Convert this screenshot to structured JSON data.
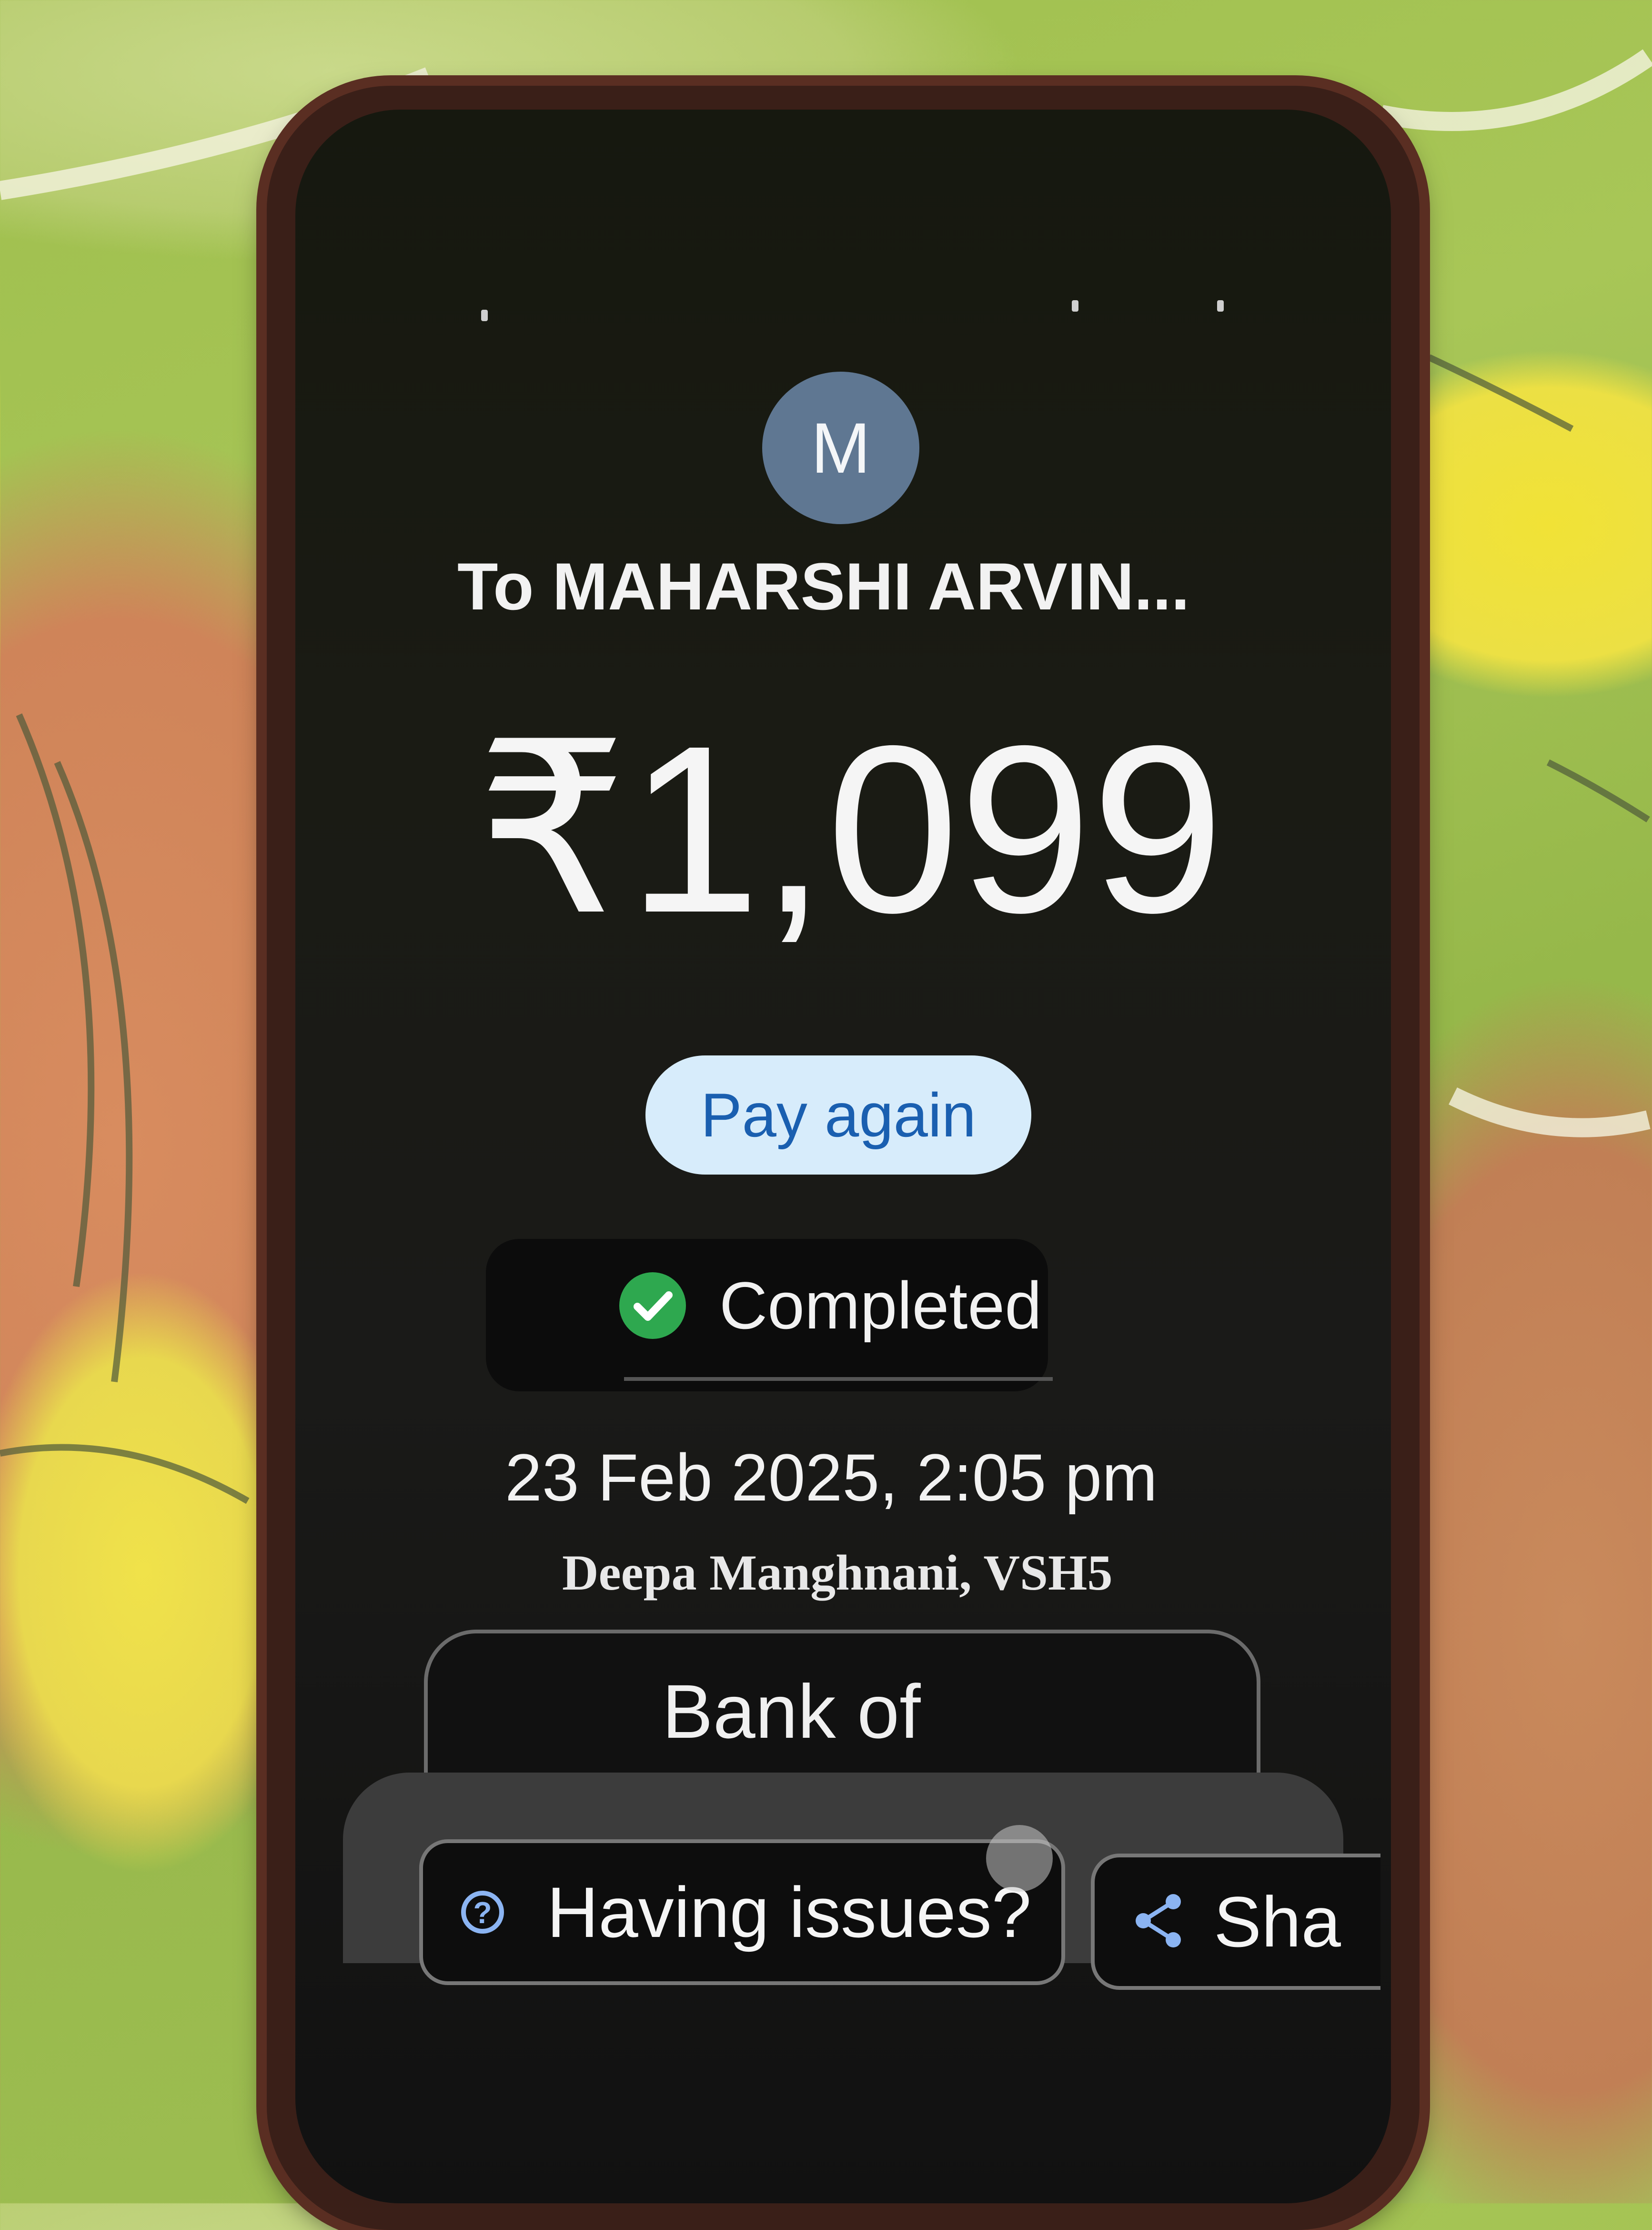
{
  "payment": {
    "avatar_initial": "M",
    "recipient": "To MAHARSHI ARVIN...",
    "amount": "₹1,099",
    "pay_again_label": "Pay again",
    "status": "Completed",
    "datetime": "23 Feb 2025, 2:05 pm",
    "payer_note": "Deepa Manghnani, VSH5",
    "bank_label": "Bank of"
  },
  "actions": {
    "issues_label": "Having issues?",
    "share_label": "Sha"
  },
  "colors": {
    "avatar": "#5f7792",
    "pay_again_bg": "#d7ecfb",
    "pay_again_text": "#1a5fb0",
    "status_check": "#2ea84f"
  },
  "icons": {
    "status": "check-circle-icon",
    "help": "help-circle-icon",
    "share": "share-icon"
  }
}
